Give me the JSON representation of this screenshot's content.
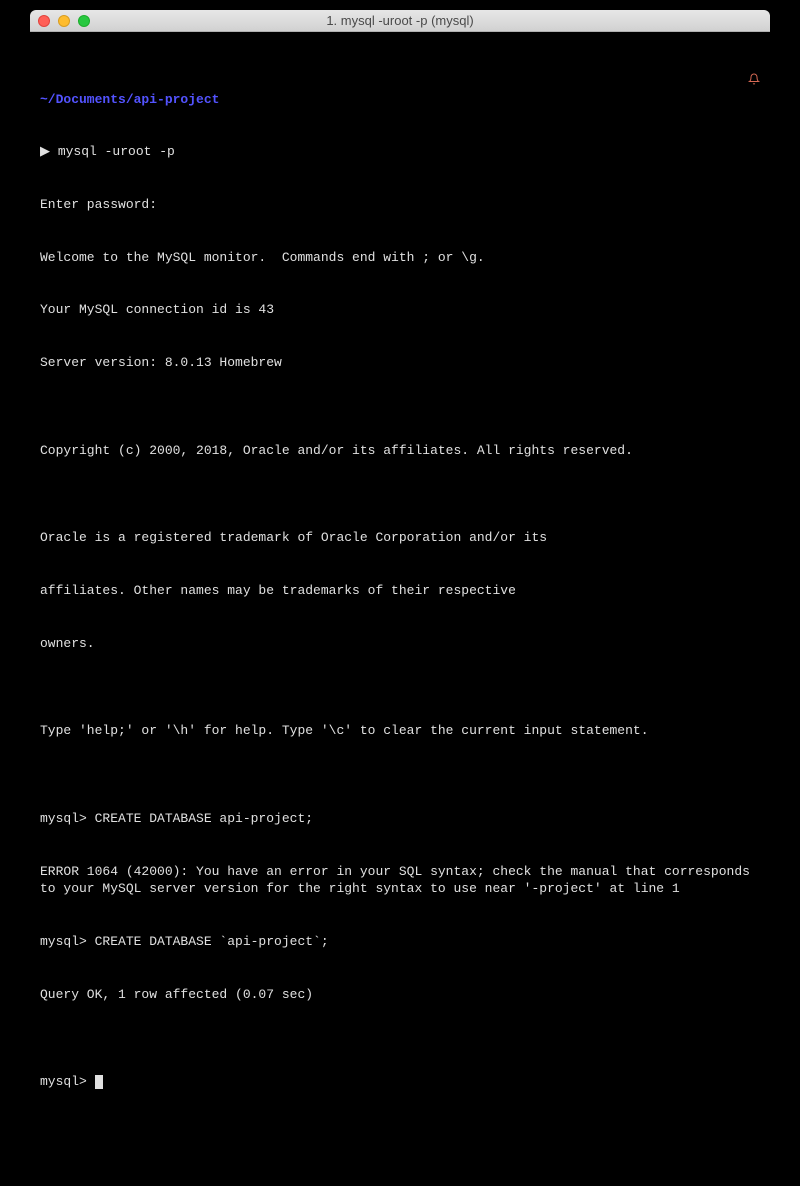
{
  "titlebar": {
    "title": "1. mysql -uroot -p (mysql)"
  },
  "terminal": {
    "cwd": "~/Documents/api-project",
    "cmd1_prefix": "▶ ",
    "cmd1": "mysql -uroot -p",
    "l1": "Enter password:",
    "l2": "Welcome to the MySQL monitor.  Commands end with ; or \\g.",
    "l3": "Your MySQL connection id is 43",
    "l4": "Server version: 8.0.13 Homebrew",
    "l5": "",
    "l6": "Copyright (c) 2000, 2018, Oracle and/or its affiliates. All rights reserved.",
    "l7": "",
    "l8": "Oracle is a registered trademark of Oracle Corporation and/or its",
    "l9": "affiliates. Other names may be trademarks of their respective",
    "l10": "owners.",
    "l11": "",
    "l12": "Type 'help;' or '\\h' for help. Type '\\c' to clear the current input statement.",
    "l13": "",
    "l14": "mysql> CREATE DATABASE api-project;",
    "l15": "ERROR 1064 (42000): You have an error in your SQL syntax; check the manual that corresponds to your MySQL server version for the right syntax to use near '-project' at line 1",
    "l16": "mysql> CREATE DATABASE `api-project`;",
    "l17": "Query OK, 1 row affected (0.07 sec)",
    "l18": "",
    "prompt_final": "mysql> "
  }
}
